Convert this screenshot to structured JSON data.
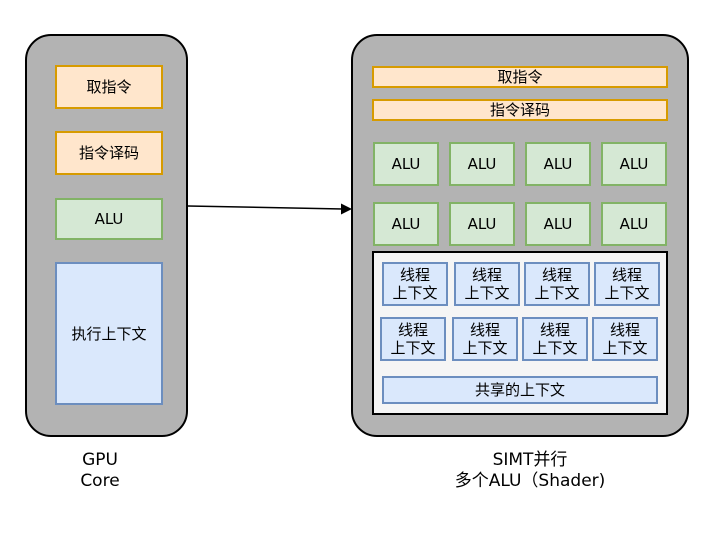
{
  "left": {
    "fetch": "取指令",
    "decode": "指令译码",
    "alu": "ALU",
    "context": "执行上下文",
    "caption_line1": "GPU",
    "caption_line2": "Core"
  },
  "right": {
    "fetch": "取指令",
    "decode": "指令译码",
    "alu_rows": [
      [
        "ALU",
        "ALU",
        "ALU",
        "ALU"
      ],
      [
        "ALU",
        "ALU",
        "ALU",
        "ALU"
      ]
    ],
    "thread_ctx_line1": "线程",
    "thread_ctx_line2": "上下文",
    "shared_context": "共享的上下文",
    "caption_line1": "SIMT并行",
    "caption_line2": "多个ALU（Shader)"
  },
  "colors": {
    "panel": "#b3b3b3",
    "orange_fill": "#ffe6cc",
    "orange_stroke": "#d79b00",
    "green_fill": "#d5e8d4",
    "green_stroke": "#82b366",
    "blue_fill": "#dae8fc",
    "blue_stroke": "#6c8ebf"
  }
}
